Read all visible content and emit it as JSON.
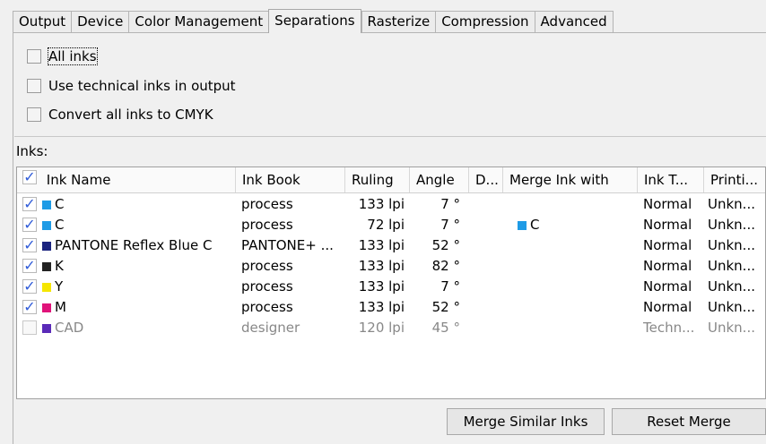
{
  "tabs": [
    {
      "label": "Output"
    },
    {
      "label": "Device"
    },
    {
      "label": "Color Management"
    },
    {
      "label": "Separations",
      "active": true
    },
    {
      "label": "Rasterize"
    },
    {
      "label": "Compression"
    },
    {
      "label": "Advanced"
    }
  ],
  "options": {
    "all_inks": "All inks",
    "use_technical": "Use technical inks in output",
    "convert_cmyk": "Convert all inks to CMYK"
  },
  "inks_label": "Inks:",
  "columns": {
    "ink_name": "Ink Name",
    "ink_book": "Ink Book",
    "ruling": "Ruling",
    "angle": "Angle",
    "d": "D...",
    "merge": "Merge Ink with",
    "ink_type": "Ink T...",
    "printing": "Printi..."
  },
  "rows": [
    {
      "checked": true,
      "color": "#1e9be6",
      "name": "C",
      "book": "process",
      "ruling": "133 lpi",
      "angle": "7 °",
      "merge": "",
      "merge_color": "",
      "type": "Normal",
      "printing": "Unkn...",
      "dim": false
    },
    {
      "checked": true,
      "color": "#1e9be6",
      "name": "C",
      "book": "process",
      "ruling": "72 lpi",
      "angle": "7 °",
      "merge": "C",
      "merge_color": "#1e9be6",
      "type": "Normal",
      "printing": "Unkn...",
      "dim": false
    },
    {
      "checked": true,
      "color": "#1a237e",
      "name": "PANTONE Reflex Blue C",
      "book": "PANTONE+ ...",
      "ruling": "133 lpi",
      "angle": "52 °",
      "merge": "",
      "merge_color": "",
      "type": "Normal",
      "printing": "Unkn...",
      "dim": false
    },
    {
      "checked": true,
      "color": "#222222",
      "name": "K",
      "book": "process",
      "ruling": "133 lpi",
      "angle": "82 °",
      "merge": "",
      "merge_color": "",
      "type": "Normal",
      "printing": "Unkn...",
      "dim": false
    },
    {
      "checked": true,
      "color": "#f5e600",
      "name": "Y",
      "book": "process",
      "ruling": "133 lpi",
      "angle": "7 °",
      "merge": "",
      "merge_color": "",
      "type": "Normal",
      "printing": "Unkn...",
      "dim": false
    },
    {
      "checked": true,
      "color": "#e0137a",
      "name": "M",
      "book": "process",
      "ruling": "133 lpi",
      "angle": "52 °",
      "merge": "",
      "merge_color": "",
      "type": "Normal",
      "printing": "Unkn...",
      "dim": false
    },
    {
      "checked": false,
      "color": "#5a2ab8",
      "name": "CAD",
      "book": "designer",
      "ruling": "120 lpi",
      "angle": "45 °",
      "merge": "",
      "merge_color": "",
      "type": "Techn...",
      "printing": "Unkn...",
      "dim": true
    }
  ],
  "buttons": {
    "merge_similar": "Merge Similar Inks",
    "reset_merge": "Reset Merge"
  }
}
